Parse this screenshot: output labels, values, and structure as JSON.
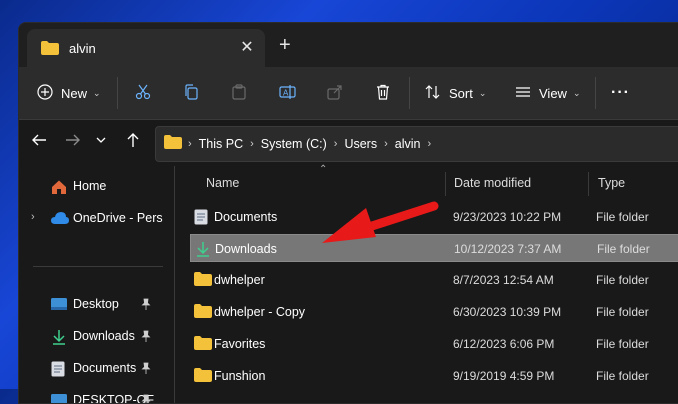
{
  "window": {
    "title": "alvin"
  },
  "toolbar": {
    "new_label": "New",
    "sort_label": "Sort",
    "view_label": "View",
    "more_label": "···"
  },
  "address": {
    "crumbs": [
      "This PC",
      "System (C:)",
      "Users",
      "alvin"
    ]
  },
  "sidebar": {
    "items": [
      {
        "label": "Home"
      },
      {
        "label": "OneDrive - Pers"
      },
      {
        "label": "Desktop"
      },
      {
        "label": "Downloads"
      },
      {
        "label": "Documents"
      },
      {
        "label": "DESKTOP-QF"
      }
    ]
  },
  "columns": {
    "name": "Name",
    "date": "Date modified",
    "type": "Type"
  },
  "files": [
    {
      "name": "Documents",
      "date": "9/23/2023 10:22 PM",
      "type": "File folder",
      "icon": "documents-folder-icon"
    },
    {
      "name": "Downloads",
      "date": "10/12/2023 7:37 AM",
      "type": "File folder",
      "icon": "downloads-folder-icon"
    },
    {
      "name": "dwhelper",
      "date": "8/7/2023 12:54 AM",
      "type": "File folder",
      "icon": "folder-icon"
    },
    {
      "name": "dwhelper - Copy",
      "date": "6/30/2023 10:39 PM",
      "type": "File folder",
      "icon": "folder-icon"
    },
    {
      "name": "Favorites",
      "date": "6/12/2023 6:06 PM",
      "type": "File folder",
      "icon": "folder-icon"
    },
    {
      "name": "Funshion",
      "date": "9/19/2019 4:59 PM",
      "type": "File folder",
      "icon": "folder-icon"
    }
  ],
  "colors": {
    "accent_red": "#e81919",
    "folder_yellow": "#f3c13a",
    "selection": "#777777",
    "background": "#191919"
  }
}
